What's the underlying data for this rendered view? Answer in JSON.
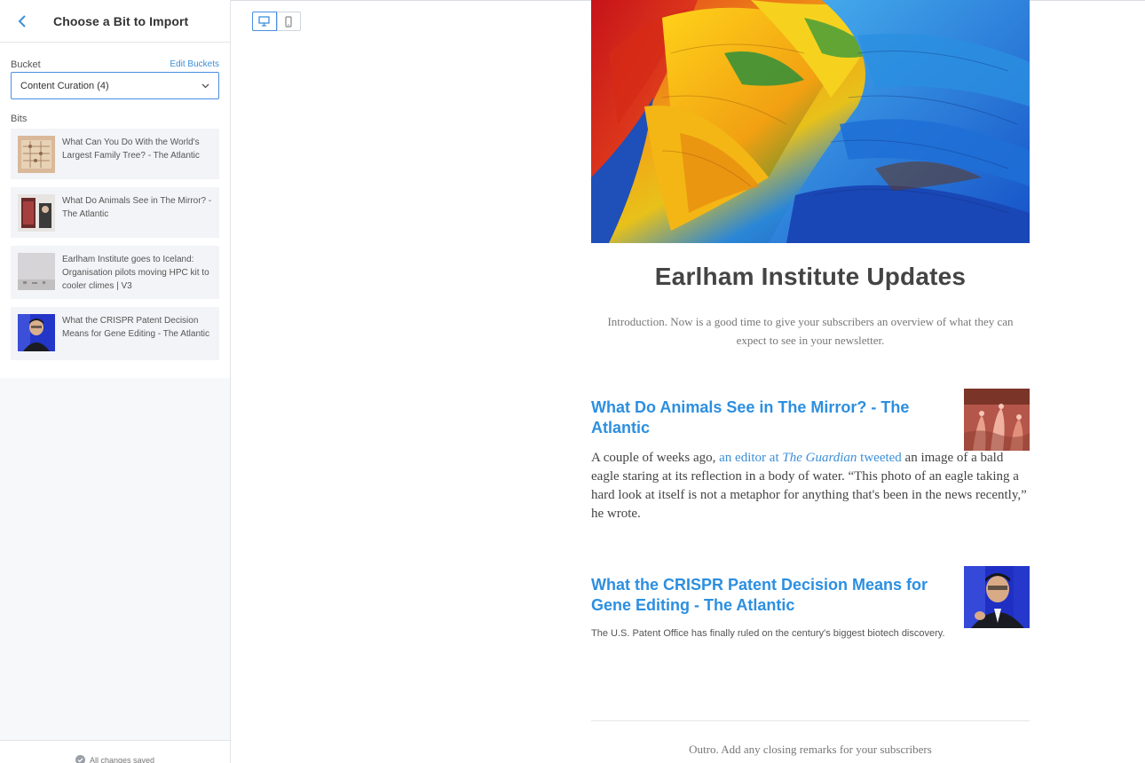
{
  "sidebar": {
    "title": "Choose a Bit to Import",
    "bucket_label": "Bucket",
    "edit_buckets": "Edit Buckets",
    "bucket_selected": "Content Curation (4)",
    "bits_label": "Bits",
    "bits": [
      {
        "title": "What Can You Do With the World's Largest Family Tree? - The Atlantic"
      },
      {
        "title": "What Do Animals See in The Mirror? - The Atlantic"
      },
      {
        "title": "Earlham Institute goes to Iceland: Organisation pilots moving HPC kit to cooler climes | V3"
      },
      {
        "title": "What the CRISPR Patent Decision Means for Gene Editing - The Atlantic"
      }
    ],
    "save_status": "All changes saved"
  },
  "newsletter": {
    "title": "Earlham Institute Updates",
    "intro": "Introduction. Now is a good time to give your subscribers an overview of what they can expect to see in your newsletter.",
    "articles": [
      {
        "title": "What Do Animals See in The Mirror? - The Atlantic",
        "body_start": "A couple of weeks ago, ",
        "link1": "an editor at ",
        "link1_italic": "The Guardian",
        "link2": "tweeted",
        "body_end": " an image of a bald eagle staring at its reflection in a body of water. “This photo of an eagle taking a hard look at itself is not a metaphor for anything that's been in the news recently,” he wrote."
      },
      {
        "title": "What the CRISPR Patent Decision Means for Gene Editing - The Atlantic",
        "body": "The U.S. Patent Office has finally ruled on the century's biggest biotech discovery."
      }
    ],
    "outro": "Outro. Add any closing remarks for your subscribers"
  },
  "colors": {
    "accent": "#4a90e2",
    "link": "#2c8fe0",
    "sidebar_bg": "#f7f8f9",
    "bit_bg": "#f2f4f7"
  },
  "icons": {
    "back": "chevron-left-icon",
    "dropdown": "chevron-down-icon",
    "desktop": "desktop-icon",
    "mobile": "mobile-icon",
    "saved": "check-circle-icon"
  }
}
